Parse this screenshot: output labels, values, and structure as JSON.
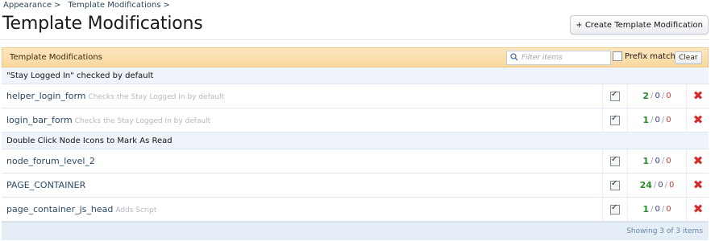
{
  "breadcrumb": {
    "items": [
      "Appearance",
      "Template Modifications"
    ],
    "separator": ">"
  },
  "page": {
    "title": "Template Modifications"
  },
  "toolbar": {
    "create_label": "+ Create Template Modification"
  },
  "panel": {
    "header": "Template Modifications",
    "filter_placeholder": "Filter items",
    "prefix_label": "Prefix match",
    "clear_label": "Clear"
  },
  "groups": [
    {
      "title": "\"Stay Logged In\" checked by default",
      "rows": [
        {
          "name": "helper_login_form",
          "desc": "Checks the Stay Logged In by default",
          "ok": "2",
          "a": "0",
          "b": "0"
        },
        {
          "name": "login_bar_form",
          "desc": "Checks the Stay Logged In by default",
          "ok": "1",
          "a": "0",
          "b": "0"
        }
      ]
    },
    {
      "title": "Double Click Node Icons to Mark As Read",
      "rows": [
        {
          "name": "node_forum_level_2",
          "desc": "",
          "ok": "1",
          "a": "0",
          "b": "0"
        },
        {
          "name": "PAGE_CONTAINER",
          "desc": "",
          "ok": "24",
          "a": "0",
          "b": "0"
        },
        {
          "name": "page_container_js_head",
          "desc": "Adds Script",
          "ok": "1",
          "a": "0",
          "b": "0"
        }
      ]
    }
  ],
  "footer": {
    "text": "Showing 3 of 3 items"
  },
  "colors": {
    "accent_header": "#f9d79c",
    "ok_green": "#2b8a2b",
    "delete_red": "#d52b2b",
    "link": "#2a4a66"
  },
  "icons": {
    "search": "search-icon",
    "delete": "delete-icon",
    "checkbox": "checkbox"
  }
}
